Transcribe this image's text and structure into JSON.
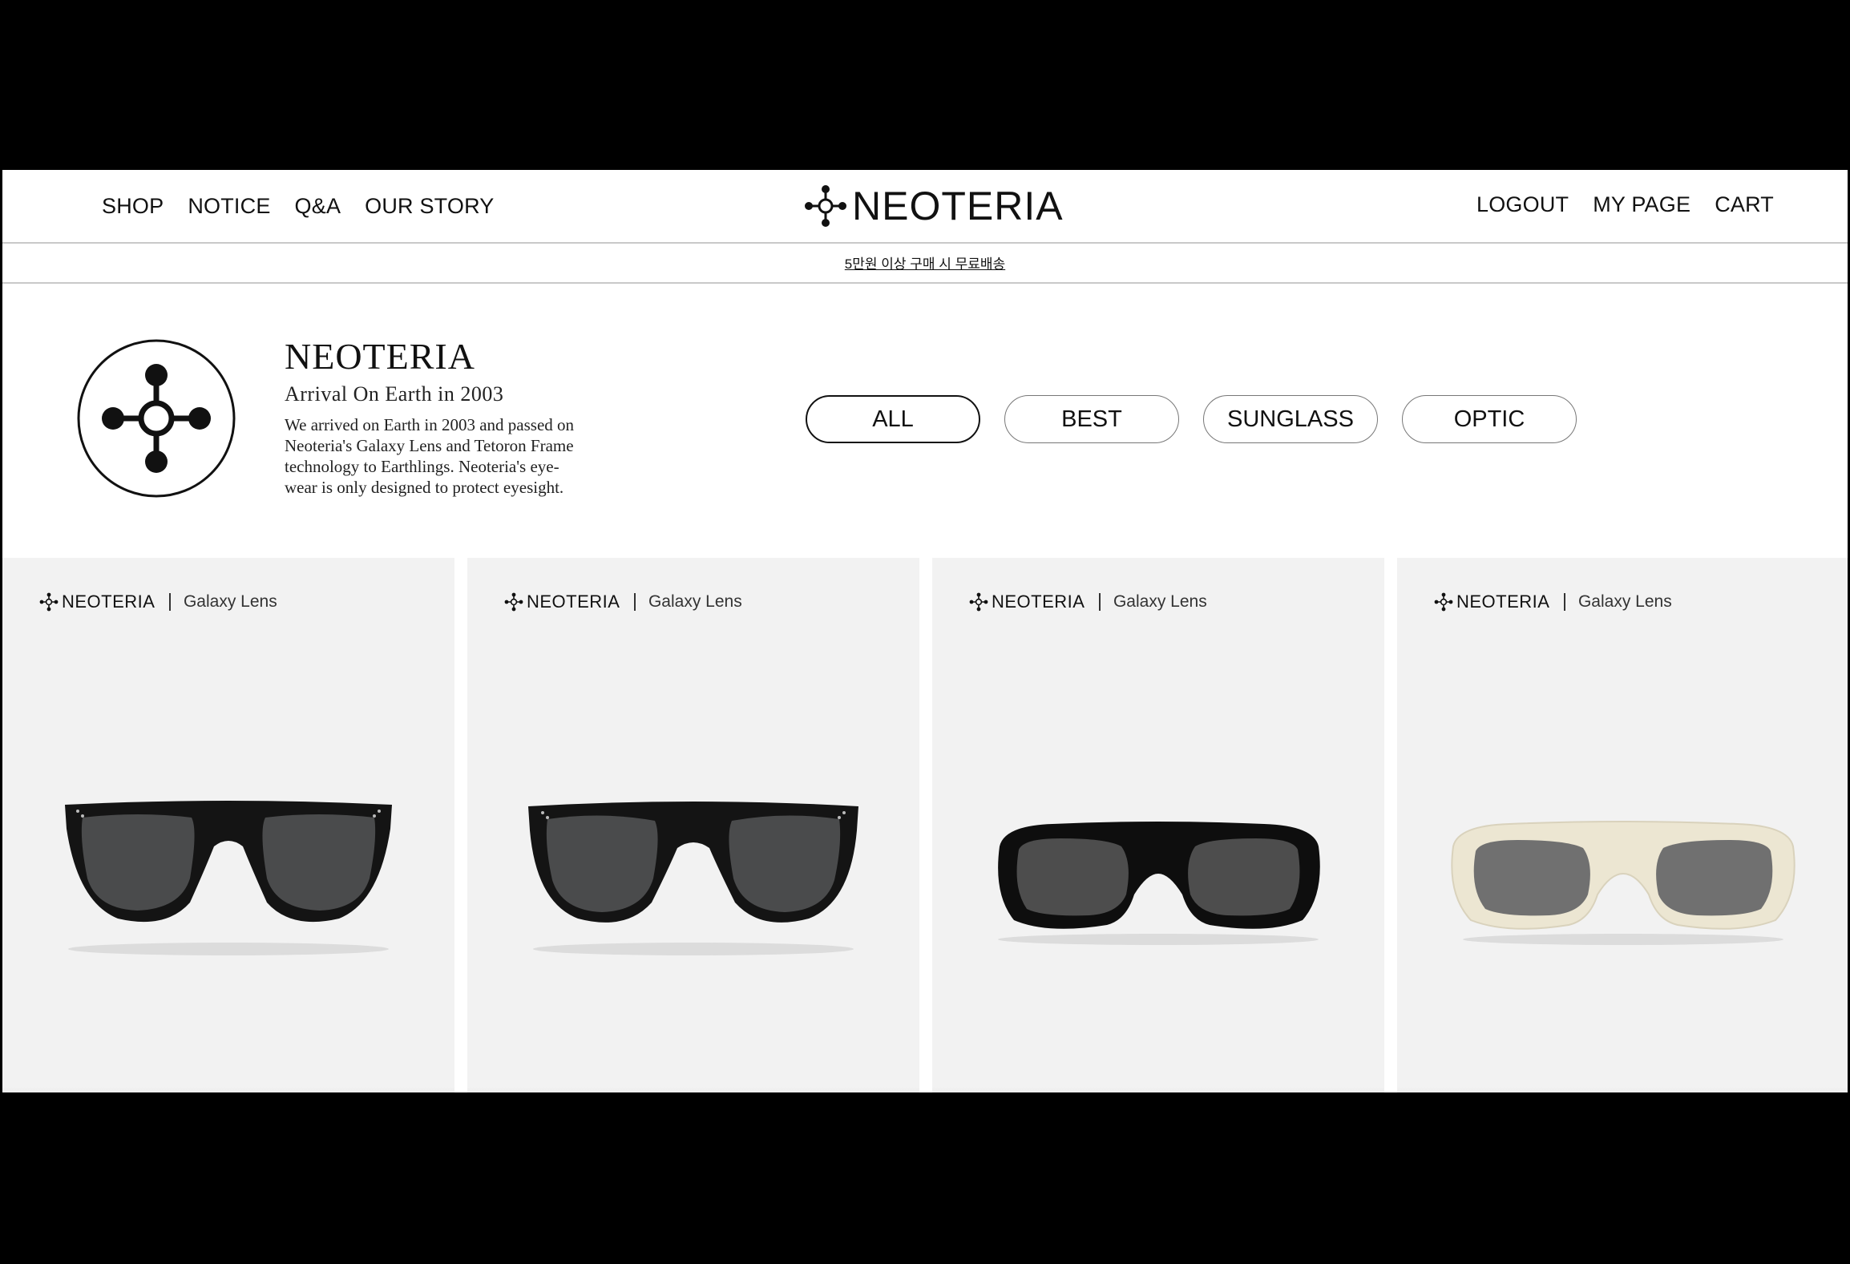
{
  "header": {
    "nav_left": [
      "SHOP",
      "NOTICE",
      "Q&A",
      "OUR STORY"
    ],
    "brand": "NEOTERIA",
    "nav_right": [
      "LOGOUT",
      "MY PAGE",
      "CART"
    ]
  },
  "banner": {
    "text": "5만원 이상 구매 시 무료배송"
  },
  "intro": {
    "title": "NEOTERIA",
    "subtitle": "Arrival On Earth in 2003",
    "description_lines": [
      "We arrived on Earth in 2003 and passed on",
      "Neoteria's Galaxy Lens and Tetoron Frame",
      "technology to Earthlings. Neoteria's eye-",
      "wear is only designed to protect eyesight."
    ]
  },
  "filters": {
    "items": [
      "ALL",
      "BEST",
      "SUNGLASS",
      "OPTIC"
    ],
    "selected": "ALL"
  },
  "products": [
    {
      "brand": "NEOTERIA",
      "line": "Galaxy Lens",
      "frame_color": "#141414",
      "lens_color": "#4a4b4c",
      "style": "square"
    },
    {
      "brand": "NEOTERIA",
      "line": "Galaxy Lens",
      "frame_color": "#141414",
      "lens_color": "#4a4b4c",
      "style": "round-square"
    },
    {
      "brand": "NEOTERIA",
      "line": "Galaxy Lens",
      "frame_color": "#0e0e0e",
      "lens_color": "#4d4d4d",
      "style": "rectangle"
    },
    {
      "brand": "NEOTERIA",
      "line": "Galaxy Lens",
      "frame_color": "#ece6d2",
      "lens_color": "#707070",
      "style": "rectangle"
    }
  ],
  "colors": {
    "background": "#ffffff",
    "card_background": "#f2f2f2",
    "divider": "#c9c9c9",
    "text": "#111111"
  }
}
